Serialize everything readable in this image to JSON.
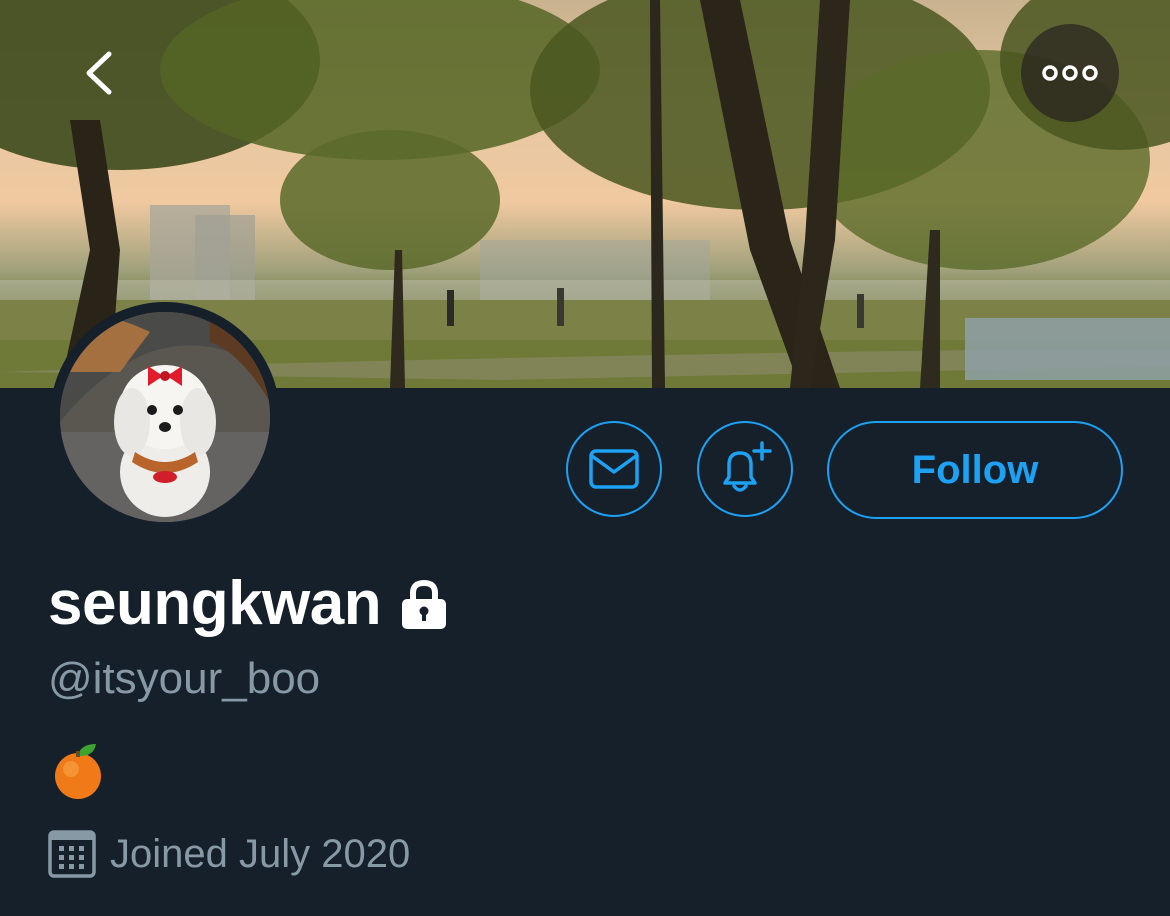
{
  "profile": {
    "display_name": "seungkwan",
    "handle": "@itsyour_boo",
    "bio_emoji": "tangerine",
    "joined": "Joined July 2020"
  },
  "actions": {
    "follow_label": "Follow"
  },
  "icons": {
    "back": "chevron-left-icon",
    "more": "more-horizontal-icon",
    "message": "envelope-icon",
    "notifications": "bell-plus-icon",
    "protected": "lock-icon",
    "calendar": "calendar-icon"
  },
  "colors": {
    "background": "#15202b",
    "accent": "#1da1f2",
    "secondary_text": "#8899a6",
    "primary_text": "#ffffff"
  }
}
